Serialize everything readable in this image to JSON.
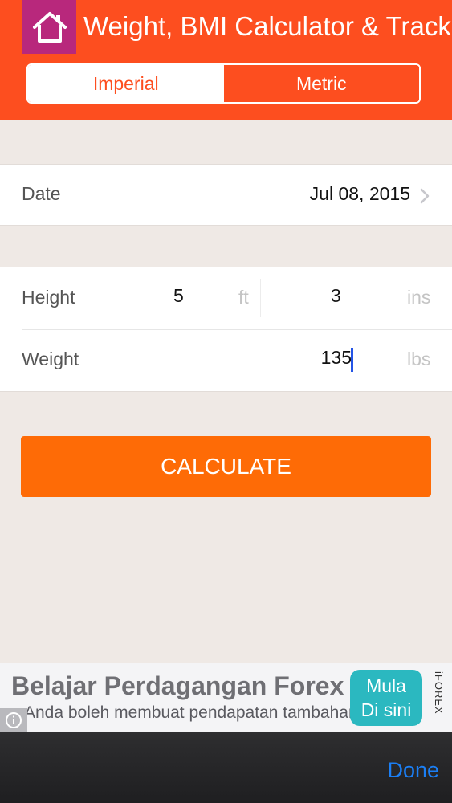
{
  "header": {
    "title": "Weight, BMI Calculator & Tracker",
    "home_icon": "home-icon",
    "segments": {
      "imperial": "Imperial",
      "metric": "Metric",
      "selected": "Imperial"
    }
  },
  "date_row": {
    "label": "Date",
    "value": "Jul 08, 2015",
    "icon": "chevron-right-icon"
  },
  "height_row": {
    "label": "Height",
    "feet": "5",
    "feet_unit": "ft",
    "inches": "3",
    "inches_unit": "ins"
  },
  "weight_row": {
    "label": "Weight",
    "value": "135",
    "unit": "lbs"
  },
  "calculate_button": "CALCULATE",
  "ad": {
    "title": "Belajar Perdagangan Forex",
    "subtitle": "Anda boleh membuat pendapatan tambahan!",
    "cta_line1": "Mula",
    "cta_line2": "Di sini",
    "brand": "iFOREX"
  },
  "keyboard_toolbar": {
    "done_label": "Done"
  },
  "colors": {
    "header": "#fd4e1f",
    "home_button": "#b8287c",
    "calculate": "#fe6b06",
    "done": "#1b7ff5"
  }
}
